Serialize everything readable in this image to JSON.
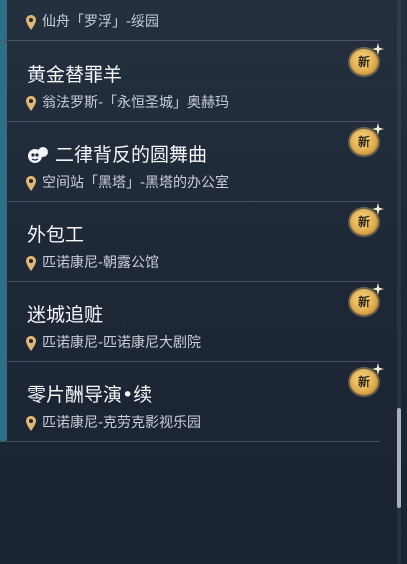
{
  "quests": [
    {
      "title": "",
      "location": "仙舟「罗浮」-绥园",
      "is_new": false
    },
    {
      "title": "黄金替罪羊",
      "location": "翁法罗斯-「永恒圣城」奥赫玛",
      "is_new": true
    },
    {
      "title": "二律背反的圆舞曲",
      "location": "空间站「黑塔」-黑塔的办公室",
      "is_new": true,
      "title_icon": "character-icon"
    },
    {
      "title": "外包工",
      "location": "匹诺康尼-朝露公馆",
      "is_new": true
    },
    {
      "title": "迷城追赃",
      "location": "匹诺康尼-匹诺康尼大剧院",
      "is_new": true
    },
    {
      "title": "零片酬导演•续",
      "location": "匹诺康尼-克劳克影视乐园",
      "is_new": true
    }
  ],
  "badge_label": "新",
  "icons": {
    "location": "location-pin-icon",
    "new": "new-badge-icon",
    "title": "character-icon"
  },
  "colors": {
    "accent_bar": "#2f6f86",
    "badge_gold": "#e2ad4f",
    "pin_gold": "#e0b874"
  }
}
